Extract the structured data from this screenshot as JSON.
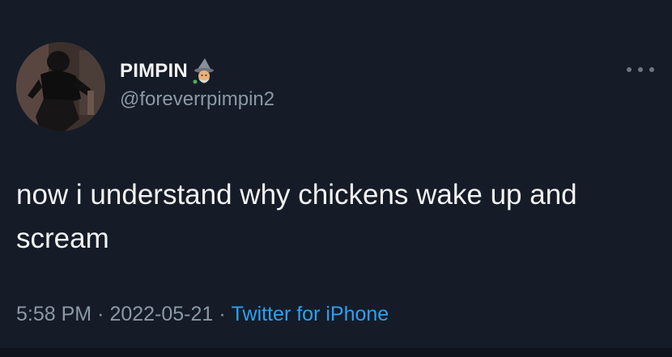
{
  "tweet": {
    "display_name": "PIMPIN",
    "name_emoji": "mage-emoji",
    "handle": "@foreverrpimpin2",
    "text": "now i understand why chickens wake up and scream",
    "time": "5:58 PM",
    "date": "2022-05-21",
    "source": "Twitter for iPhone",
    "separator": "·"
  },
  "icons": {
    "more": "more-options-icon",
    "avatar": "profile-avatar"
  },
  "colors": {
    "background": "#151c27",
    "text": "#f2f3f4",
    "muted": "#8b98a5",
    "link": "#2f9ff0"
  }
}
